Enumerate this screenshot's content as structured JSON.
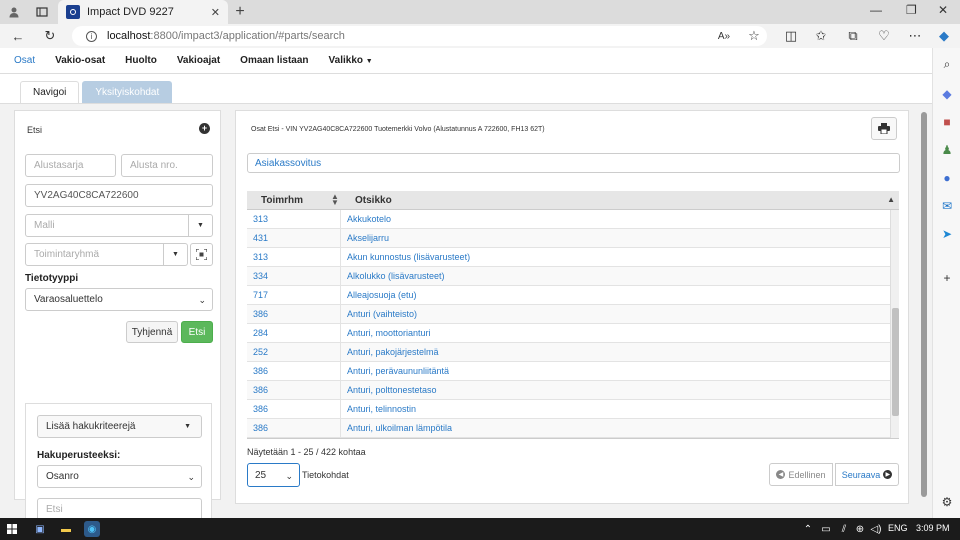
{
  "browser": {
    "tab_title": "Impact DVD 9227",
    "url_host": "localhost",
    "url_path": ":8800/impact3/application/#parts/search"
  },
  "topnav": {
    "items": [
      "Osat",
      "Vakio-osat",
      "Huolto",
      "Vakioajat",
      "Omaan listaan",
      "Valikko"
    ]
  },
  "subtabs": {
    "navigate": "Navigoi",
    "details": "Yksityiskohdat"
  },
  "left_panel": {
    "title": "Etsi",
    "chassis_series_placeholder": "Alustasarja",
    "chassis_no_placeholder": "Alusta nro.",
    "vin_value": "YV2AG40C8CA722600",
    "model_placeholder": "Malli",
    "function_group_placeholder": "Toimintaryhmä",
    "info_type_label": "Tietotyyppi",
    "info_type_value": "Varaosaluettelo",
    "clear_button": "Tyhjennä",
    "search_button": "Etsi",
    "add_criteria_button": "Lisää hakukriteerejä",
    "search_basis_label": "Hakuperusteeksi:",
    "search_basis_value": "Osanro",
    "search_placeholder": "Etsi"
  },
  "right_panel": {
    "breadcrumb": "Osat Etsi - VIN YV2AG40C8CA722600 Tuotemerkki Volvo (Alustatunnus A 722600, FH13 62T)",
    "customer_adaptation": "Asiakassovitus",
    "columns": [
      "Toimrhm",
      "Otsikko"
    ],
    "rows": [
      {
        "code": "313",
        "title": "Akkukotelo"
      },
      {
        "code": "431",
        "title": "Akselijarru"
      },
      {
        "code": "313",
        "title": "Akun kunnostus (lisävarusteet)"
      },
      {
        "code": "334",
        "title": "Alkolukko (lisävarusteet)"
      },
      {
        "code": "717",
        "title": "Alleajosuoja (etu)"
      },
      {
        "code": "386",
        "title": "Anturi (vaihteisto)"
      },
      {
        "code": "284",
        "title": "Anturi, moottorianturi"
      },
      {
        "code": "252",
        "title": "Anturi, pakojärjestelmä"
      },
      {
        "code": "386",
        "title": "Anturi, perävaununliitäntä"
      },
      {
        "code": "386",
        "title": "Anturi, polttonestetaso"
      },
      {
        "code": "386",
        "title": "Anturi, telinnostin"
      },
      {
        "code": "386",
        "title": "Anturi, ulkoilman lämpötila"
      }
    ],
    "paging_info": "Näytetään 1 - 25 / 422 kohtaa",
    "page_size": "25",
    "page_size_label": "Tietokohdat",
    "prev_button": "Edellinen",
    "next_button": "Seuraava"
  },
  "taskbar": {
    "lang": "ENG",
    "time": "3:09 PM"
  },
  "colors": {
    "link": "#2a7ac7",
    "green_button": "#5cb85c",
    "inactive_tab": "#b7cde2"
  }
}
